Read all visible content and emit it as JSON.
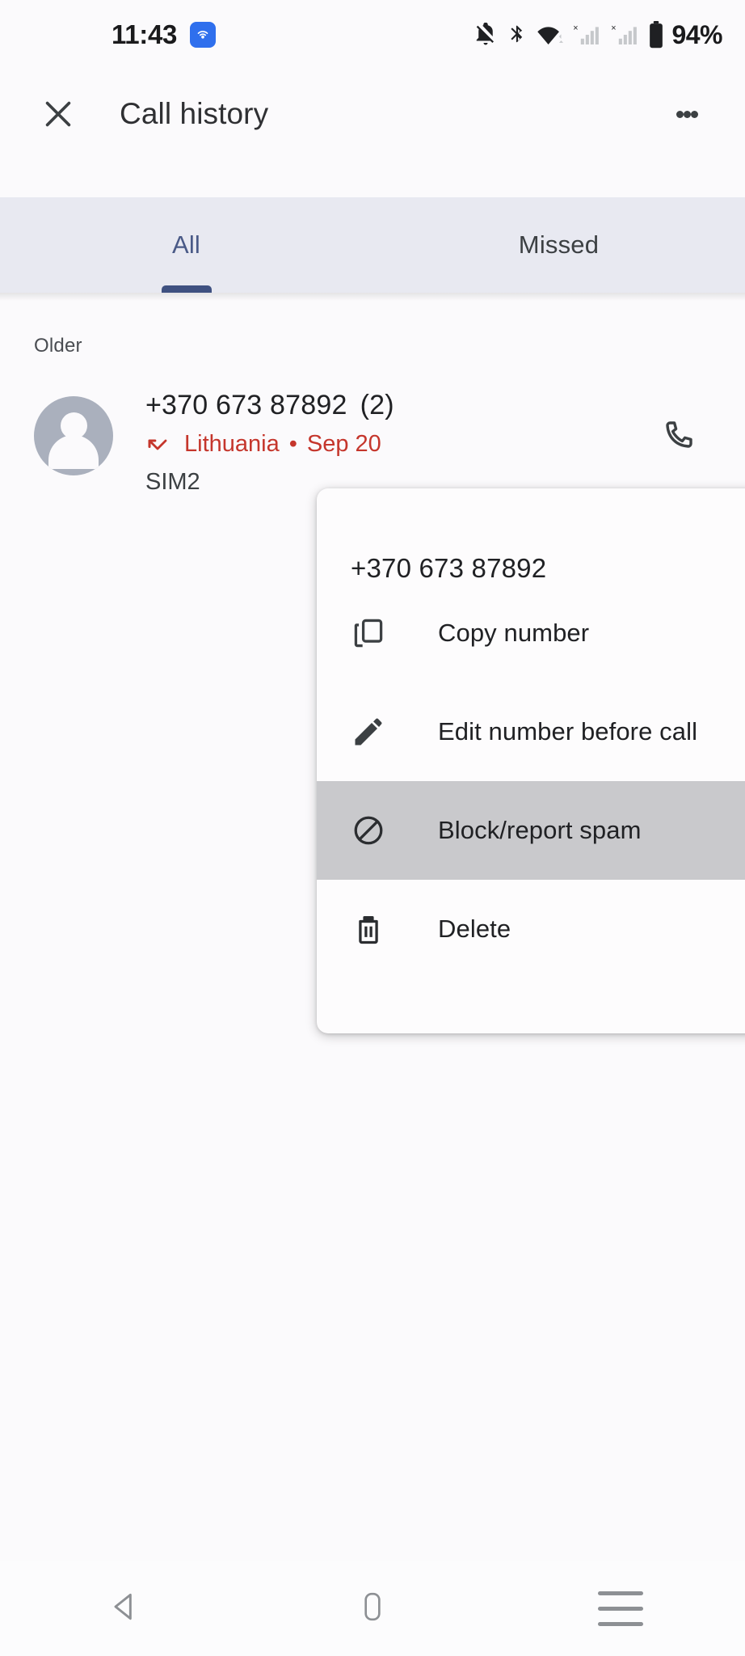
{
  "status_bar": {
    "time": "11:43",
    "battery_percent": "94%",
    "icons": [
      "cast-icon",
      "notifications-silenced-icon",
      "bluetooth-icon",
      "wifi-icon",
      "sim1-no-service-icon",
      "sim2-no-service-icon",
      "battery-icon"
    ]
  },
  "app_bar": {
    "title": "Call history",
    "close_icon": "close-icon",
    "overflow_icon": "more-vert-icon"
  },
  "tabs": [
    {
      "label": "All",
      "selected": true
    },
    {
      "label": "Missed",
      "selected": false
    }
  ],
  "list": {
    "section_header": "Older",
    "entries": [
      {
        "number": "+370 673 87892",
        "count": "(2)",
        "call_type_icon": "missed-call-icon",
        "location": "Lithuania",
        "separator": "•",
        "date": "Sep 20",
        "sim": "SIM2",
        "action_icon": "phone-icon"
      }
    ]
  },
  "popup_menu": {
    "header": "+370 673 87892",
    "items": [
      {
        "label": "Copy number",
        "icon": "copy-icon",
        "highlighted": false
      },
      {
        "label": "Edit number before call",
        "icon": "pencil-icon",
        "highlighted": false
      },
      {
        "label": "Block/report spam",
        "icon": "block-icon",
        "highlighted": true
      },
      {
        "label": "Delete",
        "icon": "trash-icon",
        "highlighted": false
      }
    ]
  },
  "nav_bar": {
    "back": "back-icon",
    "home": "home-icon",
    "recents": "recents-icon"
  },
  "colors": {
    "accent": "#3f5181",
    "missed_red": "#c5362c",
    "tab_bar_bg": "#e8e9f1",
    "page_bg": "#fbfafc",
    "highlight": "#c9c9cc"
  }
}
